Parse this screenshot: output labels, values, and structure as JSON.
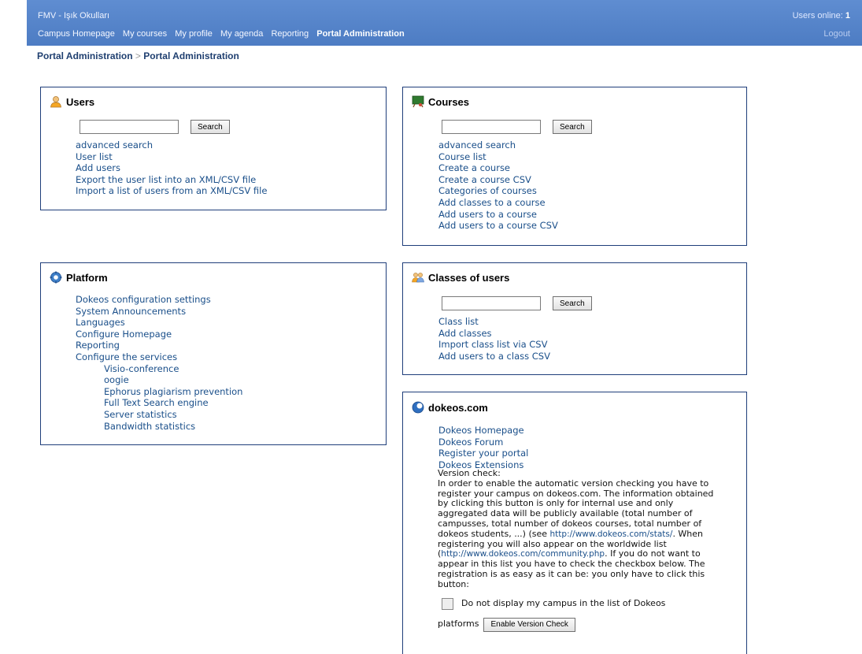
{
  "header": {
    "site_title": "FMV - Işık Okulları",
    "users_online_label": "Users online:",
    "users_online_count": "1",
    "logout": "Logout",
    "nav": [
      "Campus Homepage",
      "My courses",
      "My profile",
      "My agenda",
      "Reporting",
      "Portal Administration"
    ]
  },
  "breadcrumb": {
    "first": "Portal Administration",
    "sep": ">",
    "second": "Portal Administration"
  },
  "users_box": {
    "title": "Users",
    "search_button": "Search",
    "search_value": "",
    "links": [
      "advanced search",
      "User list",
      "Add users",
      "Export the user list into an XML/CSV file",
      "Import a list of users from an XML/CSV file"
    ]
  },
  "courses_box": {
    "title": "Courses",
    "search_button": "Search",
    "search_value": "",
    "links": [
      "advanced search",
      "Course list",
      "Create a course",
      "Create a course CSV",
      "Categories of courses",
      "Add classes to a course",
      "Add users to a course",
      "Add users to a course CSV"
    ]
  },
  "platform_box": {
    "title": "Platform",
    "links": [
      "Dokeos configuration settings",
      "System Announcements",
      "Languages",
      "Configure Homepage",
      "Reporting",
      "Configure the services"
    ],
    "services": [
      "Visio-conference",
      "oogie",
      "Ephorus plagiarism prevention",
      "Full Text Search engine",
      "Server statistics",
      "Bandwidth statistics"
    ]
  },
  "classes_box": {
    "title": "Classes of users",
    "search_button": "Search",
    "search_value": "",
    "links": [
      "Class list",
      "Add classes",
      "Import class list via CSV",
      "Add users to a class CSV"
    ]
  },
  "dokeos_box": {
    "title": "dokeos.com",
    "links": [
      "Dokeos Homepage",
      "Dokeos Forum",
      "Register your portal",
      "Dokeos Extensions"
    ],
    "version_check_label": "Version check:",
    "text1": "In order to enable the automatic version checking you have to register your campus on dokeos.com. The information obtained by clicking this button is only for internal use and only aggregated data will be publicly available (total number of campusses, total number of dokeos courses, total number of dokeos students, ...) (see ",
    "link1": "http://www.dokeos.com/stats/",
    "text2": ". When registering you will also appear on the worldwide list (",
    "link2": "http://www.dokeos.com/community.php",
    "text3": ". If you do not want to appear in this list you have to check the checkbox below. The registration is as easy as it can be: you only have to click this button:",
    "checkbox_label_1": "Do not display my campus in the list of Dokeos",
    "checkbox_label_2": "platforms",
    "button": "Enable Version Check"
  },
  "colors": {
    "header": "#5682c8",
    "link": "#1a4f8a",
    "border": "#1f3e7a"
  }
}
